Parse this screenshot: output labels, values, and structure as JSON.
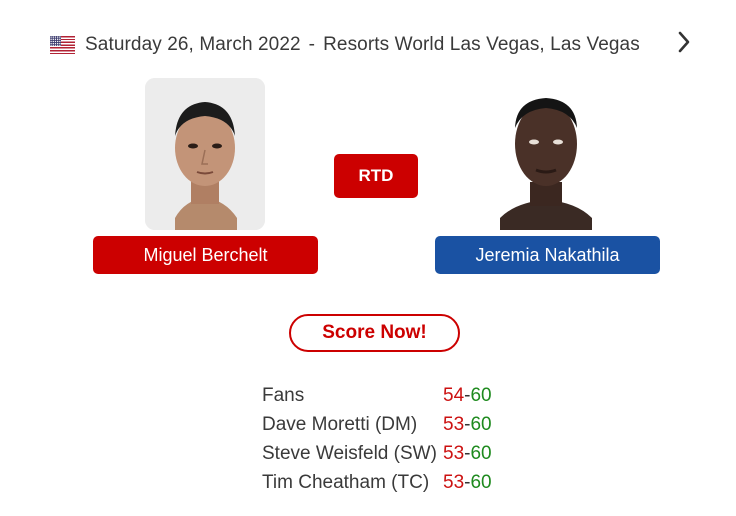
{
  "event": {
    "flag_icon": "us-flag-icon",
    "date": "Saturday 26, March 2022",
    "separator": "-",
    "venue": "Resorts World Las Vegas, Las Vegas",
    "next_icon": "chevron-right-icon"
  },
  "fight": {
    "result": "RTD",
    "red_corner": {
      "name": "Miguel Berchelt",
      "color": "#cc0000"
    },
    "blue_corner": {
      "name": "Jeremia Nakathila",
      "color": "#1a52a3"
    }
  },
  "score_button": {
    "label": "Score Now!"
  },
  "scorecards": [
    {
      "label": "Fans",
      "red": "54",
      "sep": "-",
      "blue": "60"
    },
    {
      "label": "Dave Moretti (DM)",
      "red": "53",
      "sep": "-",
      "blue": "60"
    },
    {
      "label": "Steve Weisfeld (SW)",
      "red": "53",
      "sep": "-",
      "blue": "60"
    },
    {
      "label": "Tim Cheatham (TC)",
      "red": "53",
      "sep": "-",
      "blue": "60"
    }
  ]
}
